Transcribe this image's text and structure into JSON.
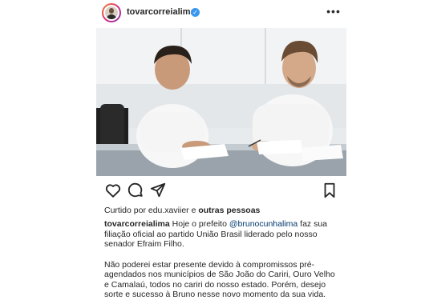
{
  "post": {
    "username": "tovarcorreialima",
    "more_label": "•••",
    "liked_by_prefix": "Curtido por",
    "liked_by_user": "edu.xaviier",
    "liked_by_joiner": "e",
    "liked_by_others": "outras pessoas",
    "caption": {
      "author": "tovarcorreialima",
      "part1": "Hoje o prefeito",
      "mention": "@brunocunhalima",
      "part2": "faz sua filiação oficial ao partido União Brasil liderado pelo nosso senador Efraim Filho.",
      "paragraph2": "Não poderei estar presente devido à compromissos pré-agendados nos municípios de São João do Cariri, Ouro Velho e Camalaú, todos no cariri do nosso estado. Porém, desejo sorte e sucesso à Bruno nesse novo momento da sua vida."
    }
  },
  "icons": {
    "like": "heart-icon",
    "comment": "comment-icon",
    "share": "send-icon",
    "save": "bookmark-icon",
    "verified": "verified-badge-icon",
    "more": "more-options-icon"
  },
  "colors": {
    "text": "#262626",
    "verified": "#3897f0",
    "mention": "#00376b"
  }
}
